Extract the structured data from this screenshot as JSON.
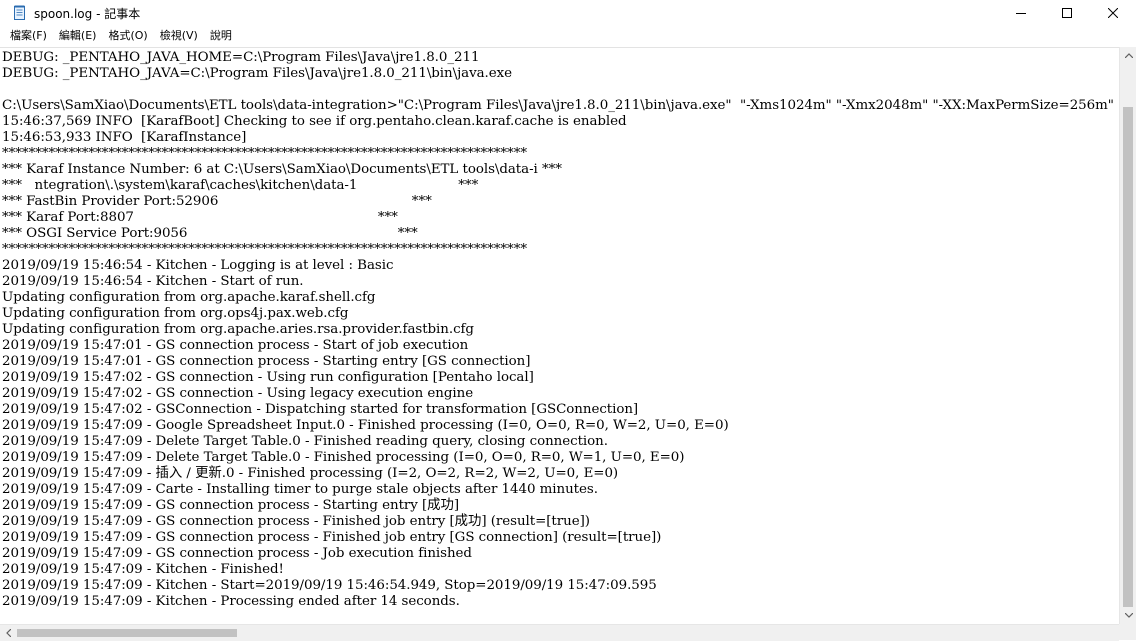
{
  "window": {
    "title": "spoon.log - 記事本",
    "icon": "notepad-icon"
  },
  "menu": {
    "items": [
      {
        "label": "檔案(F)"
      },
      {
        "label": "編輯(E)"
      },
      {
        "label": "格式(O)"
      },
      {
        "label": "檢視(V)"
      },
      {
        "label": "說明"
      }
    ]
  },
  "document": {
    "lines": [
      "DEBUG: _PENTAHO_JAVA_HOME=C:\\Program Files\\Java\\jre1.8.0_211",
      "DEBUG: _PENTAHO_JAVA=C:\\Program Files\\Java\\jre1.8.0_211\\bin\\java.exe",
      "",
      "C:\\Users\\SamXiao\\Documents\\ETL tools\\data-integration>\"C:\\Program Files\\Java\\jre1.8.0_211\\bin\\java.exe\"  \"-Xms1024m\" \"-Xmx2048m\" \"-XX:MaxPermSize=256m\"",
      "15:46:37,569 INFO  [KarafBoot] Checking to see if org.pentaho.clean.karaf.cache is enabled",
      "15:46:53,933 INFO  [KarafInstance]",
      "*******************************************************************************",
      "*** Karaf Instance Number: 6 at C:\\Users\\SamXiao\\Documents\\ETL tools\\data-i ***",
      "***   ntegration\\.\\system\\karaf\\caches\\kitchen\\data-1                        ***",
      "*** FastBin Provider Port:52906                                              ***",
      "*** Karaf Port:8807                                                          ***",
      "*** OSGI Service Port:9056                                                  ***",
      "*******************************************************************************",
      "2019/09/19 15:46:54 - Kitchen - Logging is at level : Basic",
      "2019/09/19 15:46:54 - Kitchen - Start of run.",
      "Updating configuration from org.apache.karaf.shell.cfg",
      "Updating configuration from org.ops4j.pax.web.cfg",
      "Updating configuration from org.apache.aries.rsa.provider.fastbin.cfg",
      "2019/09/19 15:47:01 - GS connection process - Start of job execution",
      "2019/09/19 15:47:01 - GS connection process - Starting entry [GS connection]",
      "2019/09/19 15:47:02 - GS connection - Using run configuration [Pentaho local]",
      "2019/09/19 15:47:02 - GS connection - Using legacy execution engine",
      "2019/09/19 15:47:02 - GSConnection - Dispatching started for transformation [GSConnection]",
      "2019/09/19 15:47:09 - Google Spreadsheet Input.0 - Finished processing (I=0, O=0, R=0, W=2, U=0, E=0)",
      "2019/09/19 15:47:09 - Delete Target Table.0 - Finished reading query, closing connection.",
      "2019/09/19 15:47:09 - Delete Target Table.0 - Finished processing (I=0, O=0, R=0, W=1, U=0, E=0)",
      "2019/09/19 15:47:09 - 插入 / 更新.0 - Finished processing (I=2, O=2, R=2, W=2, U=0, E=0)",
      "2019/09/19 15:47:09 - Carte - Installing timer to purge stale objects after 1440 minutes.",
      "2019/09/19 15:47:09 - GS connection process - Starting entry [成功]",
      "2019/09/19 15:47:09 - GS connection process - Finished job entry [成功] (result=[true])",
      "2019/09/19 15:47:09 - GS connection process - Finished job entry [GS connection] (result=[true])",
      "2019/09/19 15:47:09 - GS connection process - Job execution finished",
      "2019/09/19 15:47:09 - Kitchen - Finished!",
      "2019/09/19 15:47:09 - Kitchen - Start=2019/09/19 15:46:54.949, Stop=2019/09/19 15:47:09.595",
      "2019/09/19 15:47:09 - Kitchen - Processing ended after 14 seconds."
    ]
  }
}
